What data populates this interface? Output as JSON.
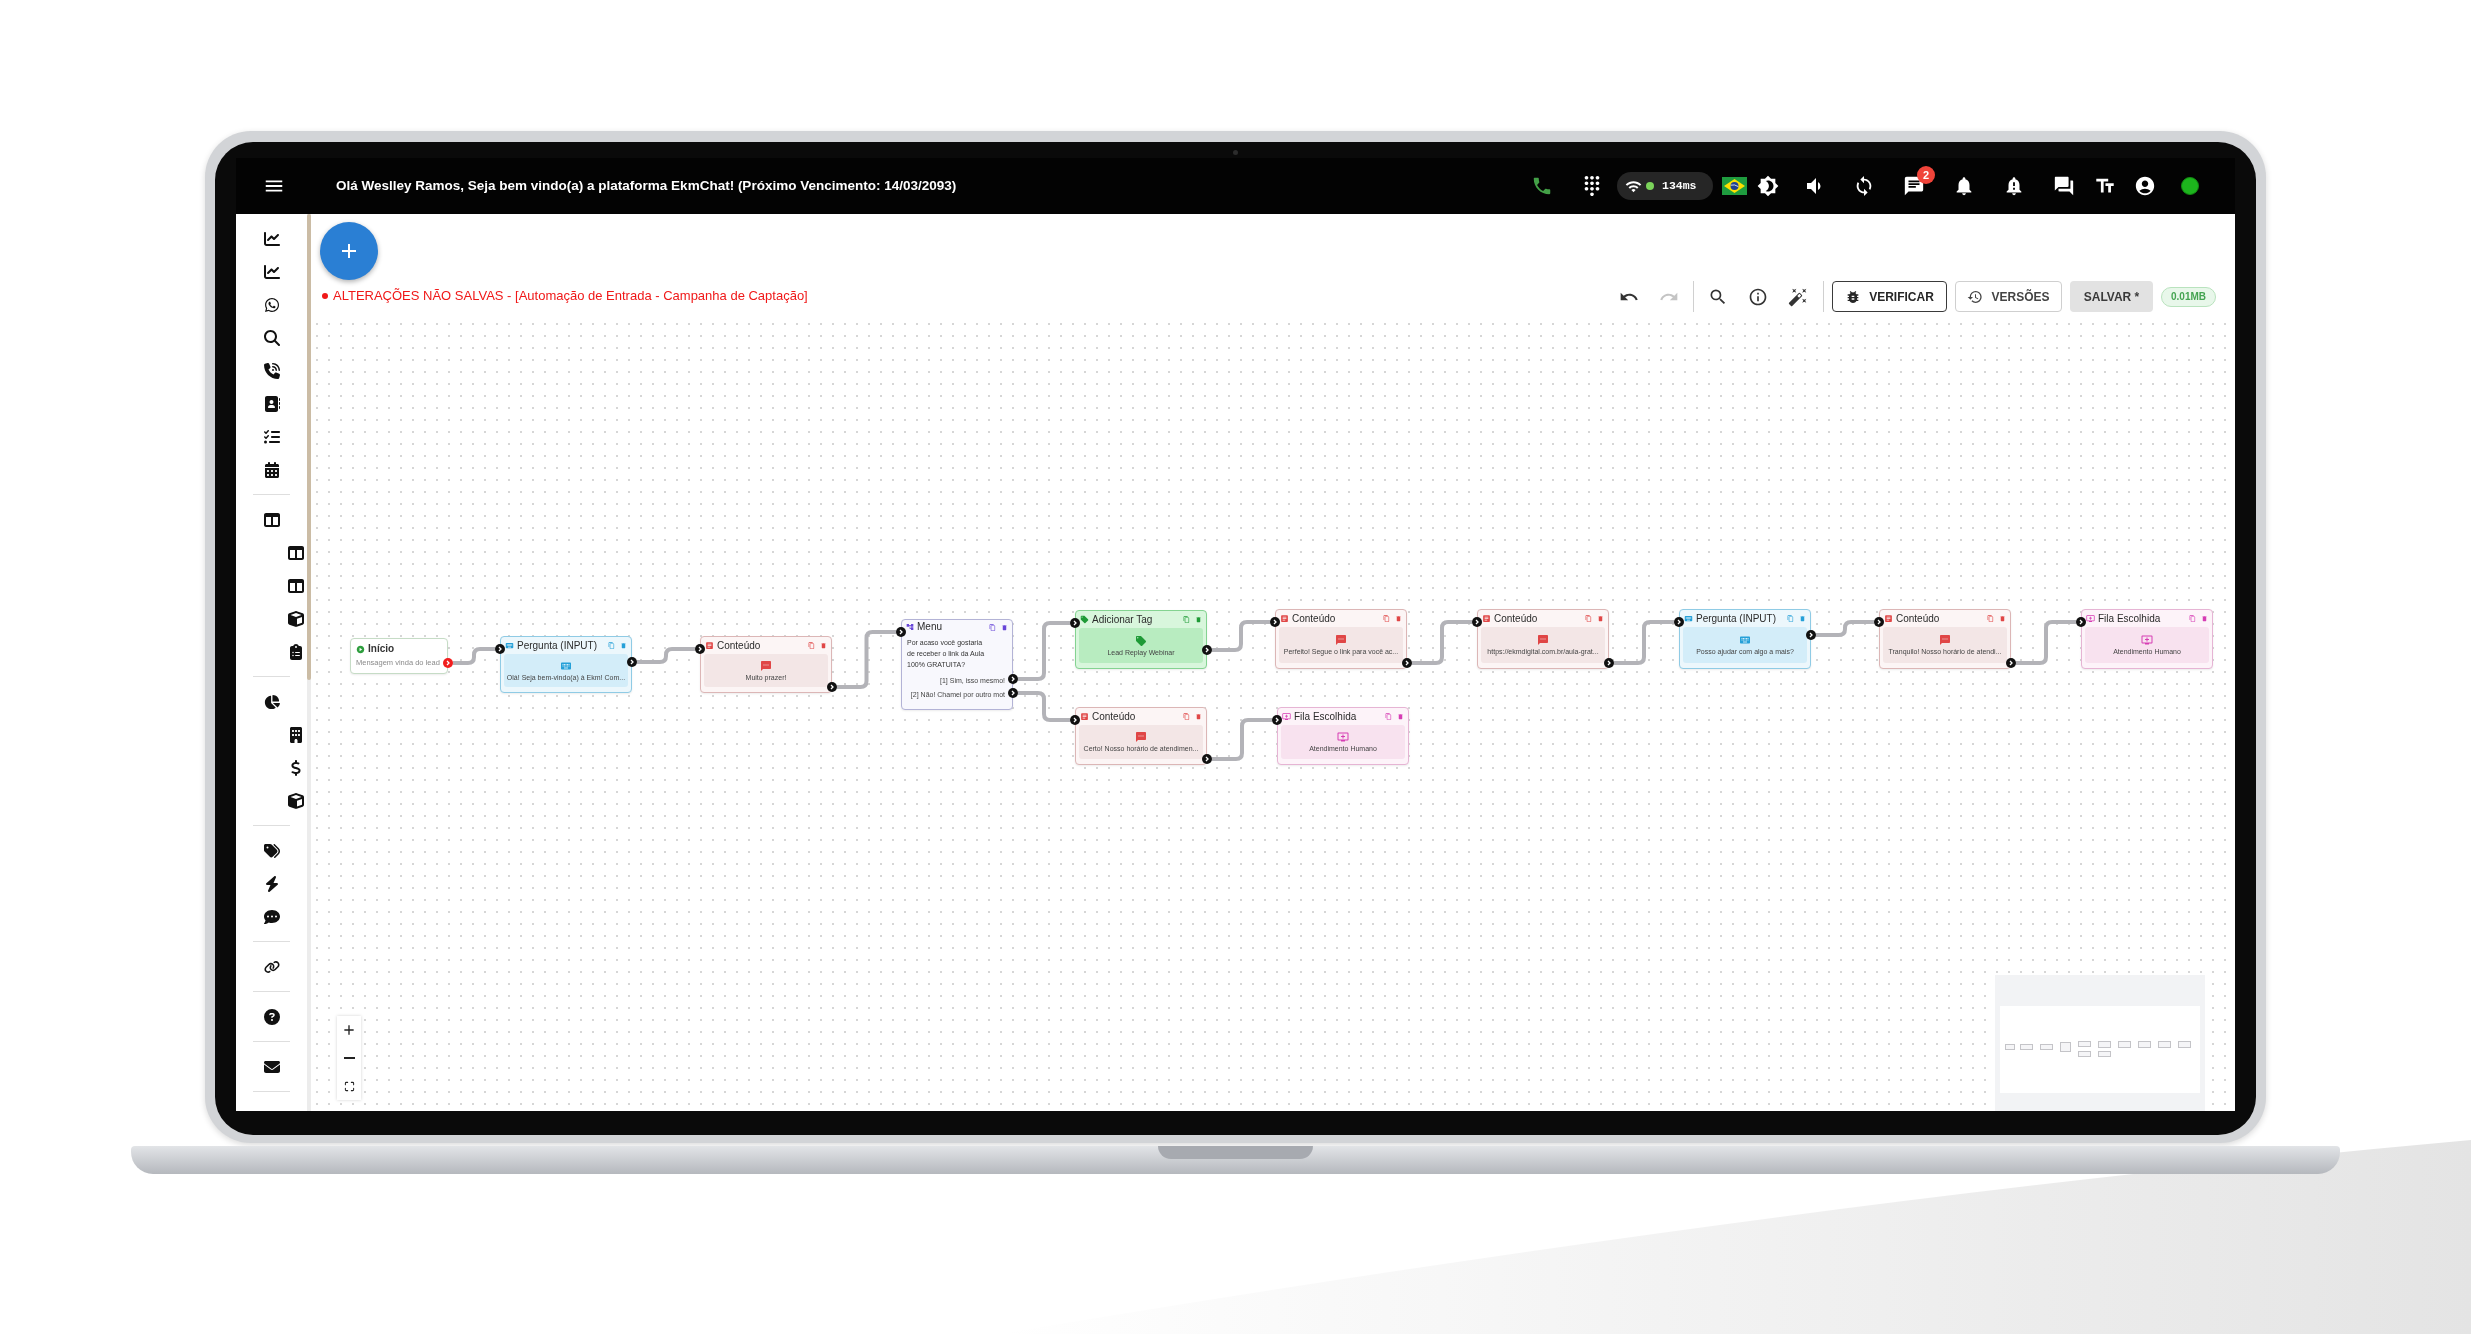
{
  "top_bar": {
    "greeting": "Olá Weslley Ramos, Seja bem vindo(a) a plataforma EkmChat! (Próximo Vencimento: 14/03/2093)",
    "latency": "134ms",
    "chat_badge": "2"
  },
  "editor": {
    "status": "ALTERAÇÕES NÃO SALVAS - [Automação de Entrada - Campanha de Captação]",
    "tools": [
      {
        "kind": "undo",
        "disabled": false
      },
      {
        "kind": "redo",
        "disabled": true
      },
      {
        "kind": "search",
        "disabled": false
      },
      {
        "kind": "info",
        "disabled": false
      },
      {
        "kind": "wand",
        "disabled": false
      }
    ],
    "buttons": [
      {
        "kind": "verify",
        "label": "VERIFICAR"
      },
      {
        "kind": "versions",
        "label": "VERSÕES"
      },
      {
        "kind": "save",
        "label": "SALVAR *"
      }
    ],
    "file_size": "0.01MB"
  },
  "flow": {
    "nodes": [
      {
        "kind": "start",
        "title": "Início",
        "text": "Mensagem vinda do lead"
      },
      {
        "kind": "input",
        "title": "Pergunta (INPUT)",
        "text": "Olá! Seja bem-vindo(a) à Ekm! Com..."
      },
      {
        "kind": "content",
        "title": "Conteúdo",
        "text": "Muito prazer!"
      },
      {
        "kind": "menu",
        "title": "Menu",
        "text": "Por acaso você gostaria de receber o link da Aula 100% GRATUITA?",
        "options": [
          "[1] Sim, isso mesmo!",
          "[2] Não! Chamei por outro mot"
        ]
      },
      {
        "kind": "tag",
        "title": "Adicionar Tag",
        "text": "Lead Replay Webinar"
      },
      {
        "kind": "content",
        "title": "Conteúdo",
        "text": "Perfeito! Segue o link para você ac..."
      },
      {
        "kind": "content",
        "title": "Conteúdo",
        "text": "Certo! Nosso horário de atendimen..."
      },
      {
        "kind": "queue",
        "title": "Fila Escolhida",
        "text": "Atendimento Humano"
      },
      {
        "kind": "content",
        "title": "Conteúdo",
        "text": "https://ekmdigital.com.br/aula-grat..."
      },
      {
        "kind": "input",
        "title": "Pergunta (INPUT)",
        "text": "Posso ajudar com algo a mais?"
      },
      {
        "kind": "content",
        "title": "Conteúdo",
        "text": "Tranquilo! Nosso horário de atendi..."
      },
      {
        "kind": "queue",
        "title": "Fila Escolhida",
        "text": "Atendimento Humano"
      }
    ]
  }
}
